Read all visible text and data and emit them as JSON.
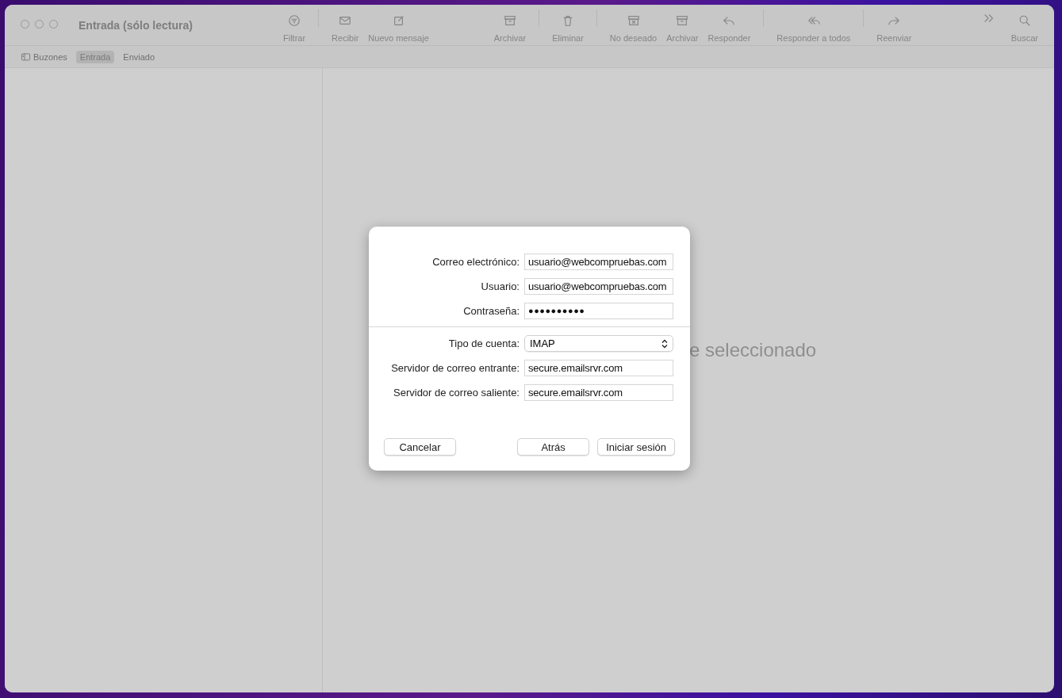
{
  "window": {
    "title": "Entrada (sólo lectura)"
  },
  "toolbar": [
    {
      "kind": "button",
      "label": "Filtrar",
      "disabled": true
    },
    {
      "kind": "divider"
    },
    {
      "kind": "button",
      "label": "Recibir",
      "disabled": true
    },
    {
      "kind": "button",
      "label": "Nuevo mensaje",
      "disabled": true
    },
    {
      "kind": "spacer"
    },
    {
      "kind": "button",
      "label": "Archivar",
      "disabled": true
    },
    {
      "kind": "divider"
    },
    {
      "kind": "button",
      "label": "Eliminar",
      "disabled": true
    },
    {
      "kind": "divider"
    },
    {
      "kind": "button",
      "label": "No deseado",
      "disabled": true
    },
    {
      "kind": "button",
      "label": "Archivar",
      "disabled": true
    },
    {
      "kind": "button",
      "label": "Responder",
      "disabled": true
    },
    {
      "kind": "divider"
    },
    {
      "kind": "button",
      "label": "Responder a todos",
      "disabled": true
    },
    {
      "kind": "divider"
    },
    {
      "kind": "button",
      "label": "Reenviar",
      "disabled": true
    },
    {
      "kind": "spacer"
    },
    {
      "kind": "more"
    },
    {
      "kind": "button",
      "label": "Buscar",
      "disabled": true
    }
  ],
  "favorites": [
    {
      "kind": "mailboxes",
      "label": "Buzones",
      "selected": false
    },
    {
      "kind": "mailbox",
      "label": "Entrada",
      "selected": true
    },
    {
      "kind": "mailbox",
      "label": "Enviado",
      "selected": false
    }
  ],
  "content": {
    "empty_message": "e seleccionado"
  },
  "dialog": {
    "sections": [
      [
        {
          "kind": "text",
          "label": "Correo electrónico:",
          "value": "usuario@webcompruebas.com"
        },
        {
          "kind": "text",
          "label": "Usuario:",
          "value": "usuario@webcompruebas.com"
        },
        {
          "kind": "password",
          "label": "Contraseña:",
          "value": "●●●●●●●●●●"
        }
      ],
      [
        {
          "kind": "select",
          "label": "Tipo de cuenta:",
          "value": "IMAP"
        },
        {
          "kind": "text",
          "label": "Servidor de correo entrante:",
          "value": "secure.emailsrvr.com"
        },
        {
          "kind": "text",
          "label": "Servidor de correo saliente:",
          "value": "secure.emailsrvr.com"
        }
      ]
    ],
    "buttons": [
      {
        "label": "Cancelar"
      },
      {
        "label": "Atrás"
      },
      {
        "label": "Iniciar sesión"
      }
    ]
  }
}
